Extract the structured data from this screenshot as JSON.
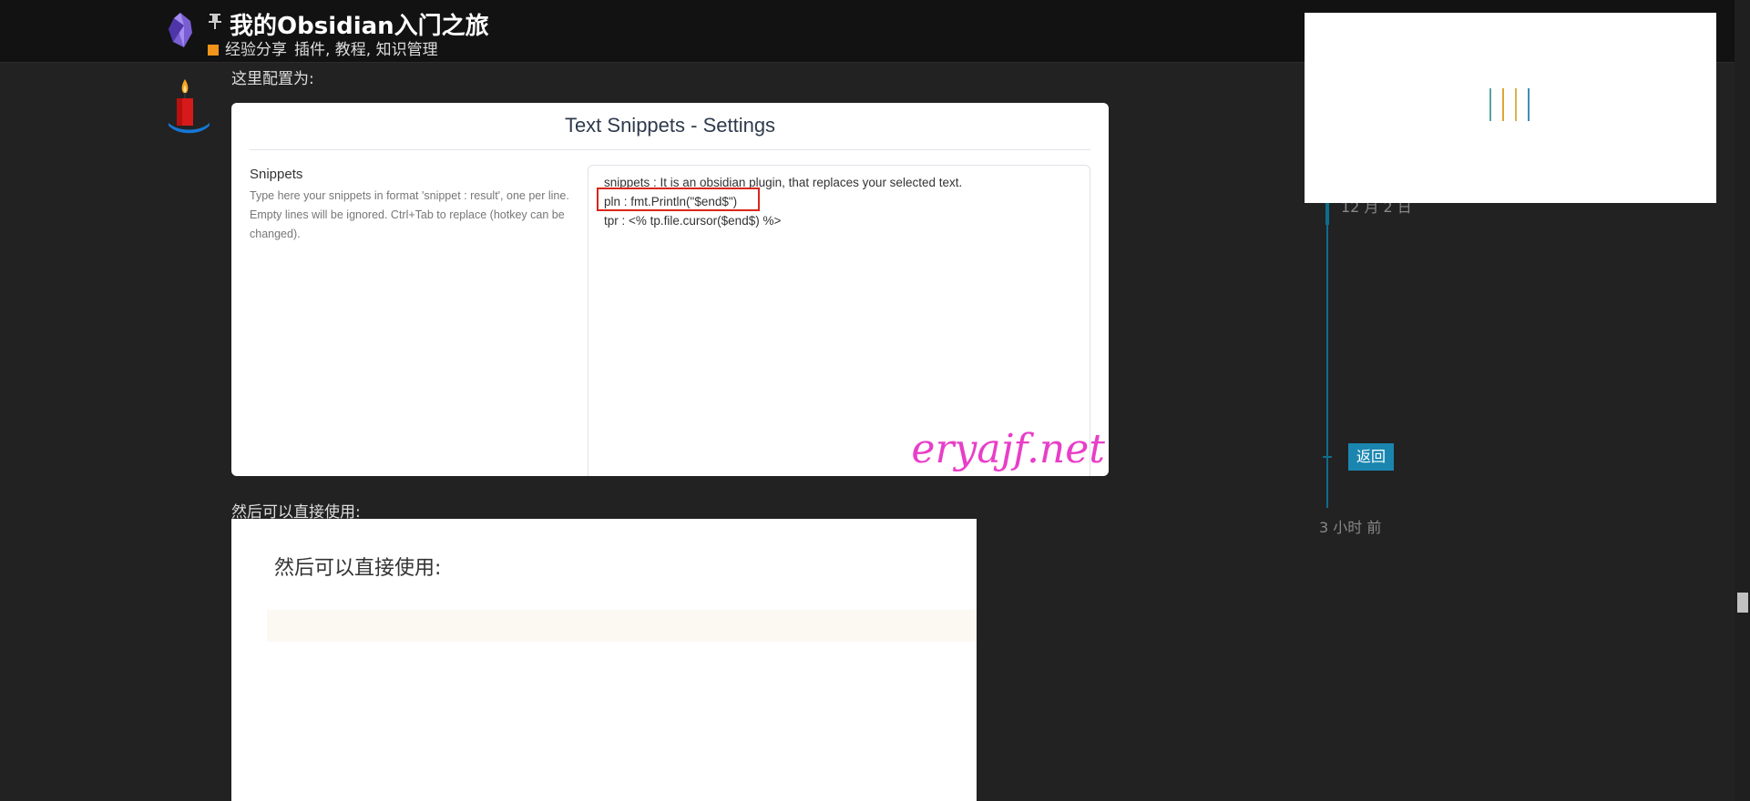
{
  "header": {
    "title": "我的Obsidian入门之旅",
    "category": "经验分享",
    "tags": "插件, 教程, 知识管理"
  },
  "article": {
    "intro_text": "这里配置为:",
    "para_after": "然后可以直接使用:"
  },
  "settings_image": {
    "title": "Text Snippets - Settings",
    "section_title": "Snippets",
    "section_desc": "Type here your snippets in format 'snippet : result', one per line. Empty lines will be ignored. Ctrl+Tab to replace (hotkey can be changed).",
    "lines": [
      "snippets : It is an obsidian plugin, that replaces your selected text.",
      "pln : fmt.Println(\"$end$\")",
      "tpr : <% tp.file.cursor($end$) %>"
    ],
    "watermark": "eryajf.net",
    "highlight_color": "#d9261c"
  },
  "usage_image": {
    "heading": "然后可以直接使用:"
  },
  "sidebar": {
    "date": "12 月 2 日",
    "back_label": "返回",
    "time_ago": "3 小时 前",
    "accent_color": "#1a86b0"
  },
  "colors": {
    "background": "#222222",
    "header_bg": "#121212",
    "category_square": "#f0941b",
    "watermark": "#e83ec8"
  }
}
